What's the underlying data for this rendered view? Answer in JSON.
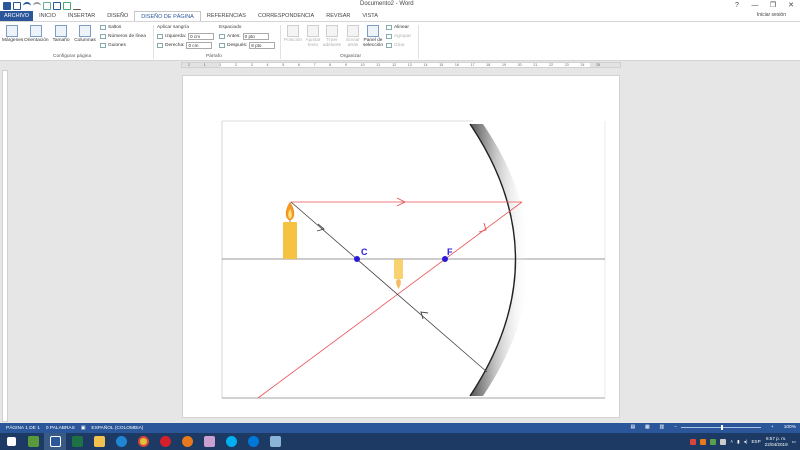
{
  "window": {
    "title": "Documento2 - Word",
    "controls": [
      "?",
      "—",
      "❐",
      "✕"
    ]
  },
  "tabs": [
    {
      "label": "ARCHIVO",
      "kind": "file"
    },
    {
      "label": "INICIO"
    },
    {
      "label": "INSERTAR"
    },
    {
      "label": "DISEÑO"
    },
    {
      "label": "DISEÑO DE PÁGINA",
      "active": true
    },
    {
      "label": "REFERENCIAS"
    },
    {
      "label": "CORRESPONDENCIA"
    },
    {
      "label": "REVISAR"
    },
    {
      "label": "VISTA"
    }
  ],
  "signin": "Iniciar sesión",
  "ribbon": {
    "margins": "Márgenes",
    "orientation": "Orientación",
    "size": "Tamaño",
    "columns": "Columnas",
    "breaks": "Saltos",
    "line_numbers": "Números de línea",
    "hyphenation": "Guiones",
    "group_page_setup": "Configurar página",
    "indent_header": "Aplicar sangría",
    "indent_left_label": "Izquierda:",
    "indent_left_value": "0 cm",
    "indent_right_label": "Derecha:",
    "indent_right_value": "0 cm",
    "spacing_header": "Espaciado",
    "spacing_before_label": "Antes:",
    "spacing_before_value": "0 pto",
    "spacing_after_label": "Después:",
    "spacing_after_value": "8 pto",
    "group_paragraph": "Párrafo",
    "position": "Posición",
    "wrap_text": "Ajustar texto",
    "bring_forward": "Traer adelante",
    "send_backward": "Enviar atrás",
    "selection_pane": "Panel de selección",
    "align": "Alinear",
    "group": "Agrupar",
    "rotate": "Girar",
    "group_arrange": "Organizar"
  },
  "ruler": {
    "numbers": [
      "2",
      "1",
      "1",
      "2",
      "3",
      "4",
      "5",
      "6",
      "7",
      "8",
      "9",
      "10",
      "11",
      "12",
      "13",
      "14",
      "15",
      "16",
      "17",
      "18",
      "19",
      "20",
      "21",
      "22",
      "23",
      "24",
      "25"
    ]
  },
  "diagram": {
    "label_center": "C",
    "label_focus": "F",
    "point_color": "#2a1ad6",
    "ray_red": "#e85050",
    "ray_dark": "#444444",
    "candle_color": "#f5c242"
  },
  "status": {
    "page": "PÁGINA 1 DE 1",
    "words": "0 PALABRAS",
    "language": "ESPAÑOL (COLOMBIA)",
    "zoom": "100%"
  },
  "taskbar": {
    "apps": [
      "windows-icon",
      "minecraft-icon",
      "word-icon",
      "excel-icon",
      "file-explorer-icon",
      "edge-icon",
      "chrome-icon",
      "opera-icon",
      "firefox-icon",
      "paint-icon",
      "skype-icon",
      "skype-business-icon",
      "mail-icon"
    ],
    "lang": "ESP",
    "time": "6:57 p. m.",
    "date": "22/04/2019"
  }
}
